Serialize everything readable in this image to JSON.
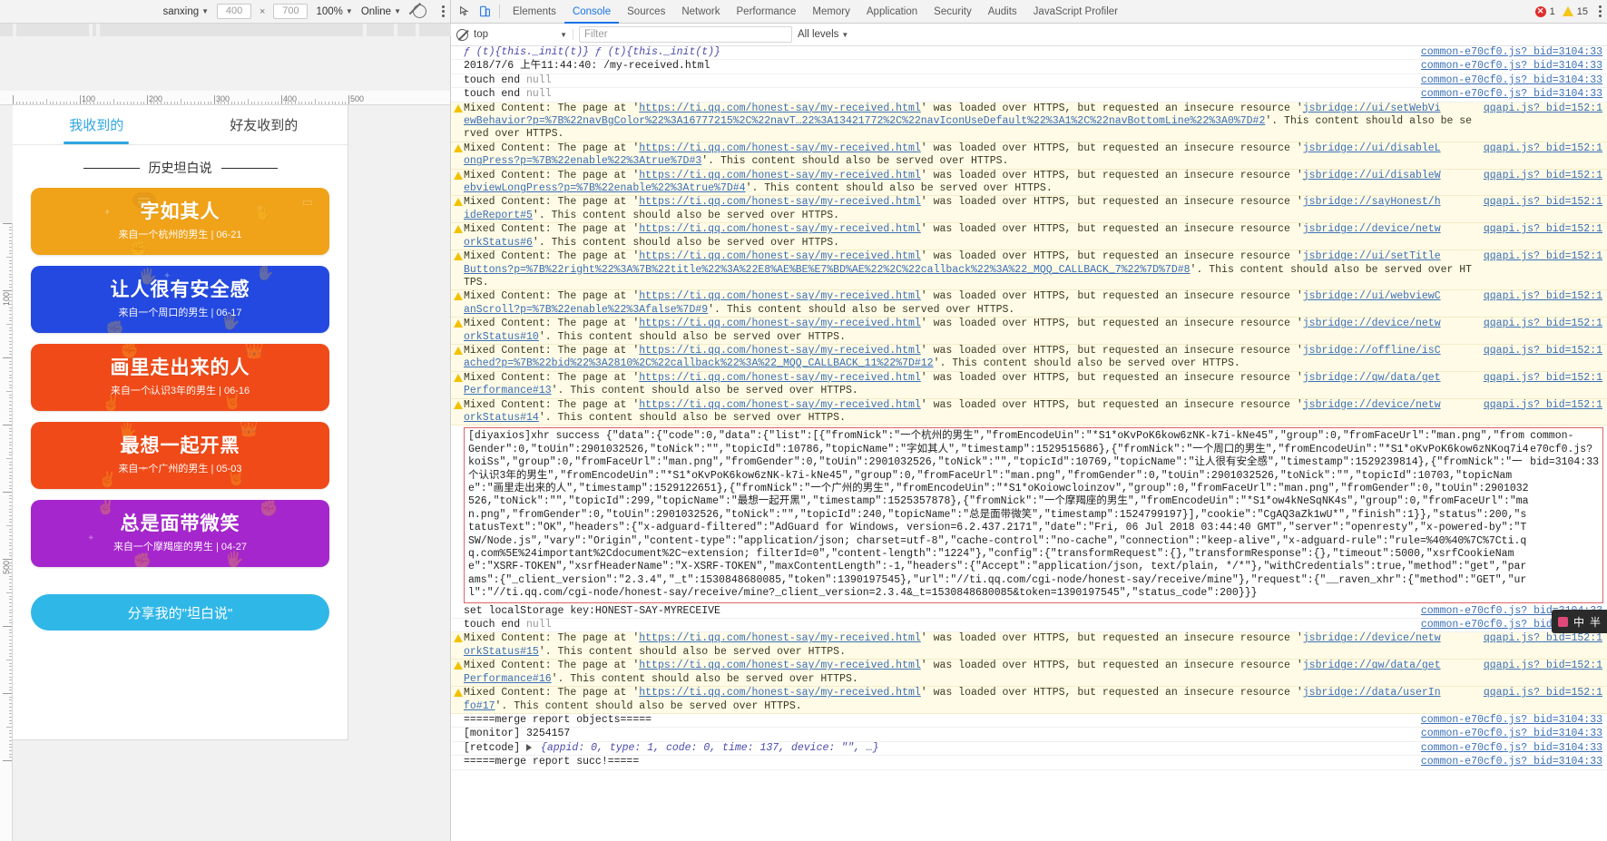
{
  "device_toolbar": {
    "device_name": "sanxing",
    "width": "400",
    "height": "700",
    "zoom": "100%",
    "network": "Online",
    "throttle_icon": "no-throttling-icon",
    "menu_icon": "kebab-menu-icon"
  },
  "ruler": {
    "h_labels": [
      "100",
      "200",
      "300",
      "400",
      "500"
    ],
    "v_labels": [
      "100",
      "500"
    ]
  },
  "page": {
    "tabs": [
      {
        "label": "我收到的",
        "active": true
      },
      {
        "label": "好友收到的",
        "active": false
      }
    ],
    "section_title": "历史坦白说",
    "cards": [
      {
        "title": "字如其人",
        "sub": "来自一个杭州的男生 | 06-21",
        "color": "#f0a219"
      },
      {
        "title": "让人很有安全感",
        "sub": "来自一个周口的男生 | 06-17",
        "color": "#2449e0"
      },
      {
        "title": "画里走出来的人",
        "sub": "来自一个认识3年的男生 | 06-16",
        "color": "#ef4a18"
      },
      {
        "title": "最想一起开黑",
        "sub": "来自一个广州的男生 | 05-03",
        "color": "#ef4a18"
      },
      {
        "title": "总是面带微笑",
        "sub": "来自一个摩羯座的男生 | 04-27",
        "color": "#a626cd"
      }
    ],
    "share_button": "分享我的\"坦白说\""
  },
  "devtools": {
    "inspect_icon": "inspect-element-icon",
    "device_icon": "toggle-device-toolbar-icon",
    "tabs": [
      {
        "label": "Elements",
        "active": false
      },
      {
        "label": "Console",
        "active": true
      },
      {
        "label": "Sources",
        "active": false
      },
      {
        "label": "Network",
        "active": false
      },
      {
        "label": "Performance",
        "active": false
      },
      {
        "label": "Memory",
        "active": false
      },
      {
        "label": "Application",
        "active": false
      },
      {
        "label": "Security",
        "active": false
      },
      {
        "label": "Audits",
        "active": false
      },
      {
        "label": "JavaScript Profiler",
        "active": false
      }
    ],
    "error_count": "1",
    "warning_count": "15",
    "settings_icon": "devtools-menu-icon",
    "console_toolbar": {
      "clear_icon": "clear-console-icon",
      "context": "top",
      "filter_placeholder": "Filter",
      "filter_value": "",
      "levels": "All levels"
    },
    "source_default": "common-e70cf0.js? bid=3104:33",
    "rows": [
      {
        "type": "log",
        "text": "ƒ (t){this._init(t)} ƒ (t){this._init(t)}",
        "src": "common-e70cf0.js? bid=3104:33",
        "style": "italic"
      },
      {
        "type": "log",
        "text": "2018/7/6 上午11:44:40: /my-received.html",
        "src": "common-e70cf0.js? bid=3104:33"
      },
      {
        "type": "log",
        "text": "touch end null",
        "src": "common-e70cf0.js? bid=3104:33"
      },
      {
        "type": "log",
        "text": "touch end null",
        "src": "common-e70cf0.js? bid=3104:33"
      },
      {
        "type": "warn",
        "line1_pre": "Mixed Content: The page at '",
        "url": "https://ti.qq.com/honest-say/my-received.html",
        "line1_mid": "' was loaded over HTTPS, but requested an insecure resource '",
        "res": "jsbridge://ui/setWebVi",
        "line2_link": "ewBehavior?p=%7B%22navBgColor%22%3A16777215%2C%22navT…22%3A13421772%2C%22navIconUseDefault%22%3A1%2C%22navBottomLine%22%3A0%7D#2",
        "line2_post": "'. This content should also be served over HTTPS.",
        "src": "qqapi.js? bid=152:1"
      },
      {
        "type": "warn",
        "line1_pre": "Mixed Content: The page at '",
        "url": "https://ti.qq.com/honest-say/my-received.html",
        "line1_mid": "' was loaded over HTTPS, but requested an insecure resource '",
        "res": "jsbridge://ui/disableL",
        "line2_link": "ongPress?p=%7B%22enable%22%3Atrue%7D#3",
        "line2_post": "'. This content should also be served over HTTPS.",
        "src": "qqapi.js? bid=152:1"
      },
      {
        "type": "warn",
        "line1_pre": "Mixed Content: The page at '",
        "url": "https://ti.qq.com/honest-say/my-received.html",
        "line1_mid": "' was loaded over HTTPS, but requested an insecure resource '",
        "res": "jsbridge://ui/disableW",
        "line2_link": "ebviewLongPress?p=%7B%22enable%22%3Atrue%7D#4",
        "line2_post": "'. This content should also be served over HTTPS.",
        "src": "qqapi.js? bid=152:1"
      },
      {
        "type": "warn",
        "line1_pre": "Mixed Content: The page at '",
        "url": "https://ti.qq.com/honest-say/my-received.html",
        "line1_mid": "' was loaded over HTTPS, but requested an insecure resource '",
        "res": "jsbridge://sayHonest/h",
        "line2_link": "ideReport#5",
        "line2_post": "'. This content should also be served over HTTPS.",
        "src": "qqapi.js? bid=152:1"
      },
      {
        "type": "warn",
        "line1_pre": "Mixed Content: The page at '",
        "url": "https://ti.qq.com/honest-say/my-received.html",
        "line1_mid": "' was loaded over HTTPS, but requested an insecure resource '",
        "res": "jsbridge://device/netw",
        "line2_link": "orkStatus#6",
        "line2_post": "'. This content should also be served over HTTPS.",
        "src": "qqapi.js? bid=152:1"
      },
      {
        "type": "warn",
        "line1_pre": "Mixed Content: The page at '",
        "url": "https://ti.qq.com/honest-say/my-received.html",
        "line1_mid": "' was loaded over HTTPS, but requested an insecure resource '",
        "res": "jsbridge://ui/setTitle",
        "line2_link": "Buttons?p=%7B%22right%22%3A%7B%22title%22%3A%22E8%AE%BE%E7%BD%AE%22%2C%22callback%22%3A%22_MQQ_CALLBACK_7%22%7D%7D#8",
        "line2_post": "'. This content should also be served over HTTPS.",
        "src": "qqapi.js? bid=152:1"
      },
      {
        "type": "warn",
        "line1_pre": "Mixed Content: The page at '",
        "url": "https://ti.qq.com/honest-say/my-received.html",
        "line1_mid": "' was loaded over HTTPS, but requested an insecure resource '",
        "res": "jsbridge://ui/webviewC",
        "line2_link": "anScroll?p=%7B%22enable%22%3Afalse%7D#9",
        "line2_post": "'. This content should also be served over HTTPS.",
        "src": "qqapi.js? bid=152:1"
      },
      {
        "type": "warn",
        "line1_pre": "Mixed Content: The page at '",
        "url": "https://ti.qq.com/honest-say/my-received.html",
        "line1_mid": "' was loaded over HTTPS, but requested an insecure resource '",
        "res": "jsbridge://device/netw",
        "line2_link": "orkStatus#10",
        "line2_post": "'. This content should also be served over HTTPS.",
        "src": "qqapi.js? bid=152:1"
      },
      {
        "type": "warn",
        "line1_pre": "Mixed Content: The page at '",
        "url": "https://ti.qq.com/honest-say/my-received.html",
        "line1_mid": "' was loaded over HTTPS, but requested an insecure resource '",
        "res": "jsbridge://offline/isC",
        "line2_link": "ached?p=%7B%22bid%22%3A2810%2C%22callback%22%3A%22_MQQ_CALLBACK_11%22%7D#12",
        "line2_post": "'. This content should also be served over HTTPS.",
        "src": "qqapi.js? bid=152:1"
      },
      {
        "type": "warn",
        "line1_pre": "Mixed Content: The page at '",
        "url": "https://ti.qq.com/honest-say/my-received.html",
        "line1_mid": "' was loaded over HTTPS, but requested an insecure resource '",
        "res": "jsbridge://qw/data/get",
        "line2_link": "Performance#13",
        "line2_post": "'. This content should also be served over HTTPS.",
        "src": "qqapi.js? bid=152:1"
      },
      {
        "type": "warn",
        "line1_pre": "Mixed Content: The page at '",
        "url": "https://ti.qq.com/honest-say/my-received.html",
        "line1_mid": "' was loaded over HTTPS, but requested an insecure resource '",
        "res": "jsbridge://device/netw",
        "line2_link": "orkStatus#14",
        "line2_post": "'. This content should also be served over HTTPS.",
        "src": "qqapi.js? bid=152:1"
      }
    ],
    "xhr_block": {
      "src": "common-e70cf0.js? bid=3104:33",
      "text": "[diyaxios]xhr success {\"data\":{\"code\":0,\"data\":{\"list\":[{\"fromNick\":\"一个杭州的男生\",\"fromEncodeUin\":\"*S1*oKvPoK6kow6zNK-k7i-kNe45\",\"group\":0,\"fromFaceUrl\":\"man.png\",\"fromGender\":0,\"toUin\":2901032526,\"toNick\":\"\",\"topicId\":10786,\"topicName\":\"字如其人\",\"timestamp\":1529515686},{\"fromNick\":\"一个周口的男生\",\"fromEncodeUin\":\"*S1*oKvPoK6kow6zNKoq7i4koiSs\",\"group\":0,\"fromFaceUrl\":\"man.png\",\"fromGender\":0,\"toUin\":2901032526,\"toNick\":\"\",\"topicId\":10769,\"topicName\":\"让人很有安全感\",\"timestamp\":1529239814},{\"fromNick\":\"一个认识3年的男生\",\"fromEncodeUin\":\"*S1*oKvPoK6kow6zNK-k7i-kNe45\",\"group\":0,\"fromFaceUrl\":\"man.png\",\"fromGender\":0,\"toUin\":2901032526,\"toNick\":\"\",\"topicId\":10703,\"topicName\":\"画里走出来的人\",\"timestamp\":1529122651},{\"fromNick\":\"一个广州的男生\",\"fromEncodeUin\":\"*S1*oKoiowcloinzov\",\"group\":0,\"fromFaceUrl\":\"man.png\",\"fromGender\":0,\"toUin\":2901032526,\"toNick\":\"\",\"topicId\":299,\"topicName\":\"最想一起开黑\",\"timestamp\":1525357878},{\"fromNick\":\"一个摩羯座的男生\",\"fromEncodeUin\":\"*S1*ow4kNeSqNK4s\",\"group\":0,\"fromFaceUrl\":\"man.png\",\"fromGender\":0,\"toUin\":2901032526,\"toNick\":\"\",\"topicId\":240,\"topicName\":\"总是面带微笑\",\"timestamp\":1524799197}],\"cookie\":\"CgAQ3aZk1wU*\",\"finish\":1}},\"status\":200,\"statusText\":\"OK\",\"headers\":{\"x-adguard-filtered\":\"AdGuard for Windows, version=6.2.437.2171\",\"date\":\"Fri, 06 Jul 2018 03:44:40 GMT\",\"server\":\"openresty\",\"x-powered-by\":\"TSW/Node.js\",\"vary\":\"Origin\",\"content-type\":\"application/json; charset=utf-8\",\"cache-control\":\"no-cache\",\"connection\":\"keep-alive\",\"x-adguard-rule\":\"rule=%40%40%7C%7Cti.qq.com%5E%24important%2Cdocument%2C~extension; filterId=0\",\"content-length\":\"1224\"},\"config\":{\"transformRequest\":{},\"transformResponse\":{},\"timeout\":5000,\"xsrfCookieName\":\"XSRF-TOKEN\",\"xsrfHeaderName\":\"X-XSRF-TOKEN\",\"maxContentLength\":-1,\"headers\":{\"Accept\":\"application/json, text/plain, */*\"},\"withCredentials\":true,\"method\":\"get\",\"params\":{\"_client_version\":\"2.3.4\",\"_t\":1530848680085,\"token\":1390197545},\"url\":\"//ti.qq.com/cgi-node/honest-say/receive/mine\"},\"request\":{\"__raven_xhr\":{\"method\":\"GET\",\"url\":\"//ti.qq.com/cgi-node/honest-say/receive/mine?_client_version=2.3.4&_t=1530848680085&token=1390197545\",\"status_code\":200}}}"
    },
    "rows_after": [
      {
        "type": "log",
        "text": "set localStorage key:HONEST-SAY-MYRECEIVE",
        "src": "common-e70cf0.js? bid=3104:33"
      },
      {
        "type": "log",
        "text": "touch end null",
        "src": "common-e70cf0.js? bid=3104:33"
      },
      {
        "type": "warn",
        "line1_pre": "Mixed Content: The page at '",
        "url": "https://ti.qq.com/honest-say/my-received.html",
        "line1_mid": "' was loaded over HTTPS, but requested an insecure resource '",
        "res": "jsbridge://device/netw",
        "line2_link": "orkStatus#15",
        "line2_post": "'. This content should also be served over HTTPS.",
        "src": "qqapi.js? bid=152:1"
      },
      {
        "type": "warn",
        "line1_pre": "Mixed Content: The page at '",
        "url": "https://ti.qq.com/honest-say/my-received.html",
        "line1_mid": "' was loaded over HTTPS, but requested an insecure resource '",
        "res": "jsbridge://qw/data/get",
        "line2_link": "Performance#16",
        "line2_post": "'. This content should also be served over HTTPS.",
        "src": "qqapi.js? bid=152:1"
      },
      {
        "type": "warn",
        "line1_pre": "Mixed Content: The page at '",
        "url": "https://ti.qq.com/honest-say/my-received.html",
        "line1_mid": "' was loaded over HTTPS, but requested an insecure resource '",
        "res": "jsbridge://data/userIn",
        "line2_link": "fo#17",
        "line2_post": "'. This content should also be served over HTTPS.",
        "src": "qqapi.js? bid=152:1"
      },
      {
        "type": "log",
        "text": "=====merge report objects=====",
        "src": "common-e70cf0.js? bid=3104:33"
      },
      {
        "type": "log",
        "text": "[monitor] 3254157",
        "src": "common-e70cf0.js? bid=3104:33"
      },
      {
        "type": "log",
        "text": "[retcode] ▶ {appid: 0, type: 1, code: 0, time: 137, device: \"\", …}",
        "src": "common-e70cf0.js? bid=3104:33"
      },
      {
        "type": "log",
        "text": "=====merge report succ!=====",
        "src": "common-e70cf0.js? bid=3104:33"
      }
    ],
    "ime_badge": {
      "lang": "中",
      "mode": "半",
      "icon": "ime-indicator-icon"
    }
  }
}
